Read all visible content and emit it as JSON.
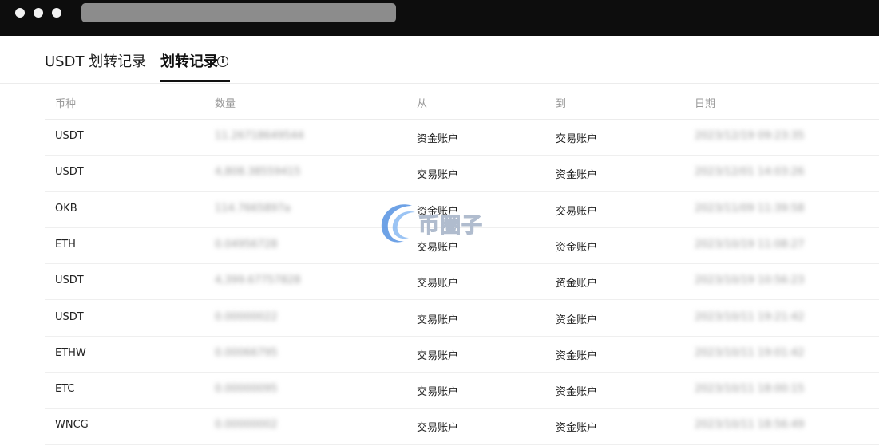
{
  "tabs": [
    {
      "label": "USDT 划转记录"
    },
    {
      "label": "划转记录"
    }
  ],
  "table": {
    "headers": [
      "币种",
      "数量",
      "从",
      "到",
      "日期"
    ],
    "rows": [
      {
        "coin": "USDT",
        "amount": "11.26718649544",
        "from": "资金账户",
        "to": "交易账户",
        "date": "2023/12/19 09:23:35"
      },
      {
        "coin": "USDT",
        "amount": "4,808.38559415",
        "from": "交易账户",
        "to": "资金账户",
        "date": "2023/12/01 14:03:26"
      },
      {
        "coin": "OKB",
        "amount": "114.7665897a",
        "from": "资金账户",
        "to": "交易账户",
        "date": "2023/11/09 11:39:58"
      },
      {
        "coin": "ETH",
        "amount": "0.04956728",
        "from": "交易账户",
        "to": "资金账户",
        "date": "2023/10/19 11:08:27"
      },
      {
        "coin": "USDT",
        "amount": "4,399.67757828",
        "from": "交易账户",
        "to": "资金账户",
        "date": "2023/10/19 10:56:23"
      },
      {
        "coin": "USDT",
        "amount": "0.00000022",
        "from": "交易账户",
        "to": "资金账户",
        "date": "2023/10/11 19:21:42"
      },
      {
        "coin": "ETHW",
        "amount": "0.00066795",
        "from": "交易账户",
        "to": "资金账户",
        "date": "2023/10/11 19:01:42"
      },
      {
        "coin": "ETC",
        "amount": "0.00000095",
        "from": "交易账户",
        "to": "资金账户",
        "date": "2023/10/11 18:00:15"
      },
      {
        "coin": "WNCG",
        "amount": "0.00000002",
        "from": "交易账户",
        "to": "资金账户",
        "date": "2023/10/11 18:56:49"
      }
    ]
  },
  "watermark": {
    "text": "币圈子"
  },
  "colors": {
    "titlebar": "#0d0d0d",
    "urlbar": "#8c8c8c",
    "watermark_blue": "#4a8be0"
  }
}
